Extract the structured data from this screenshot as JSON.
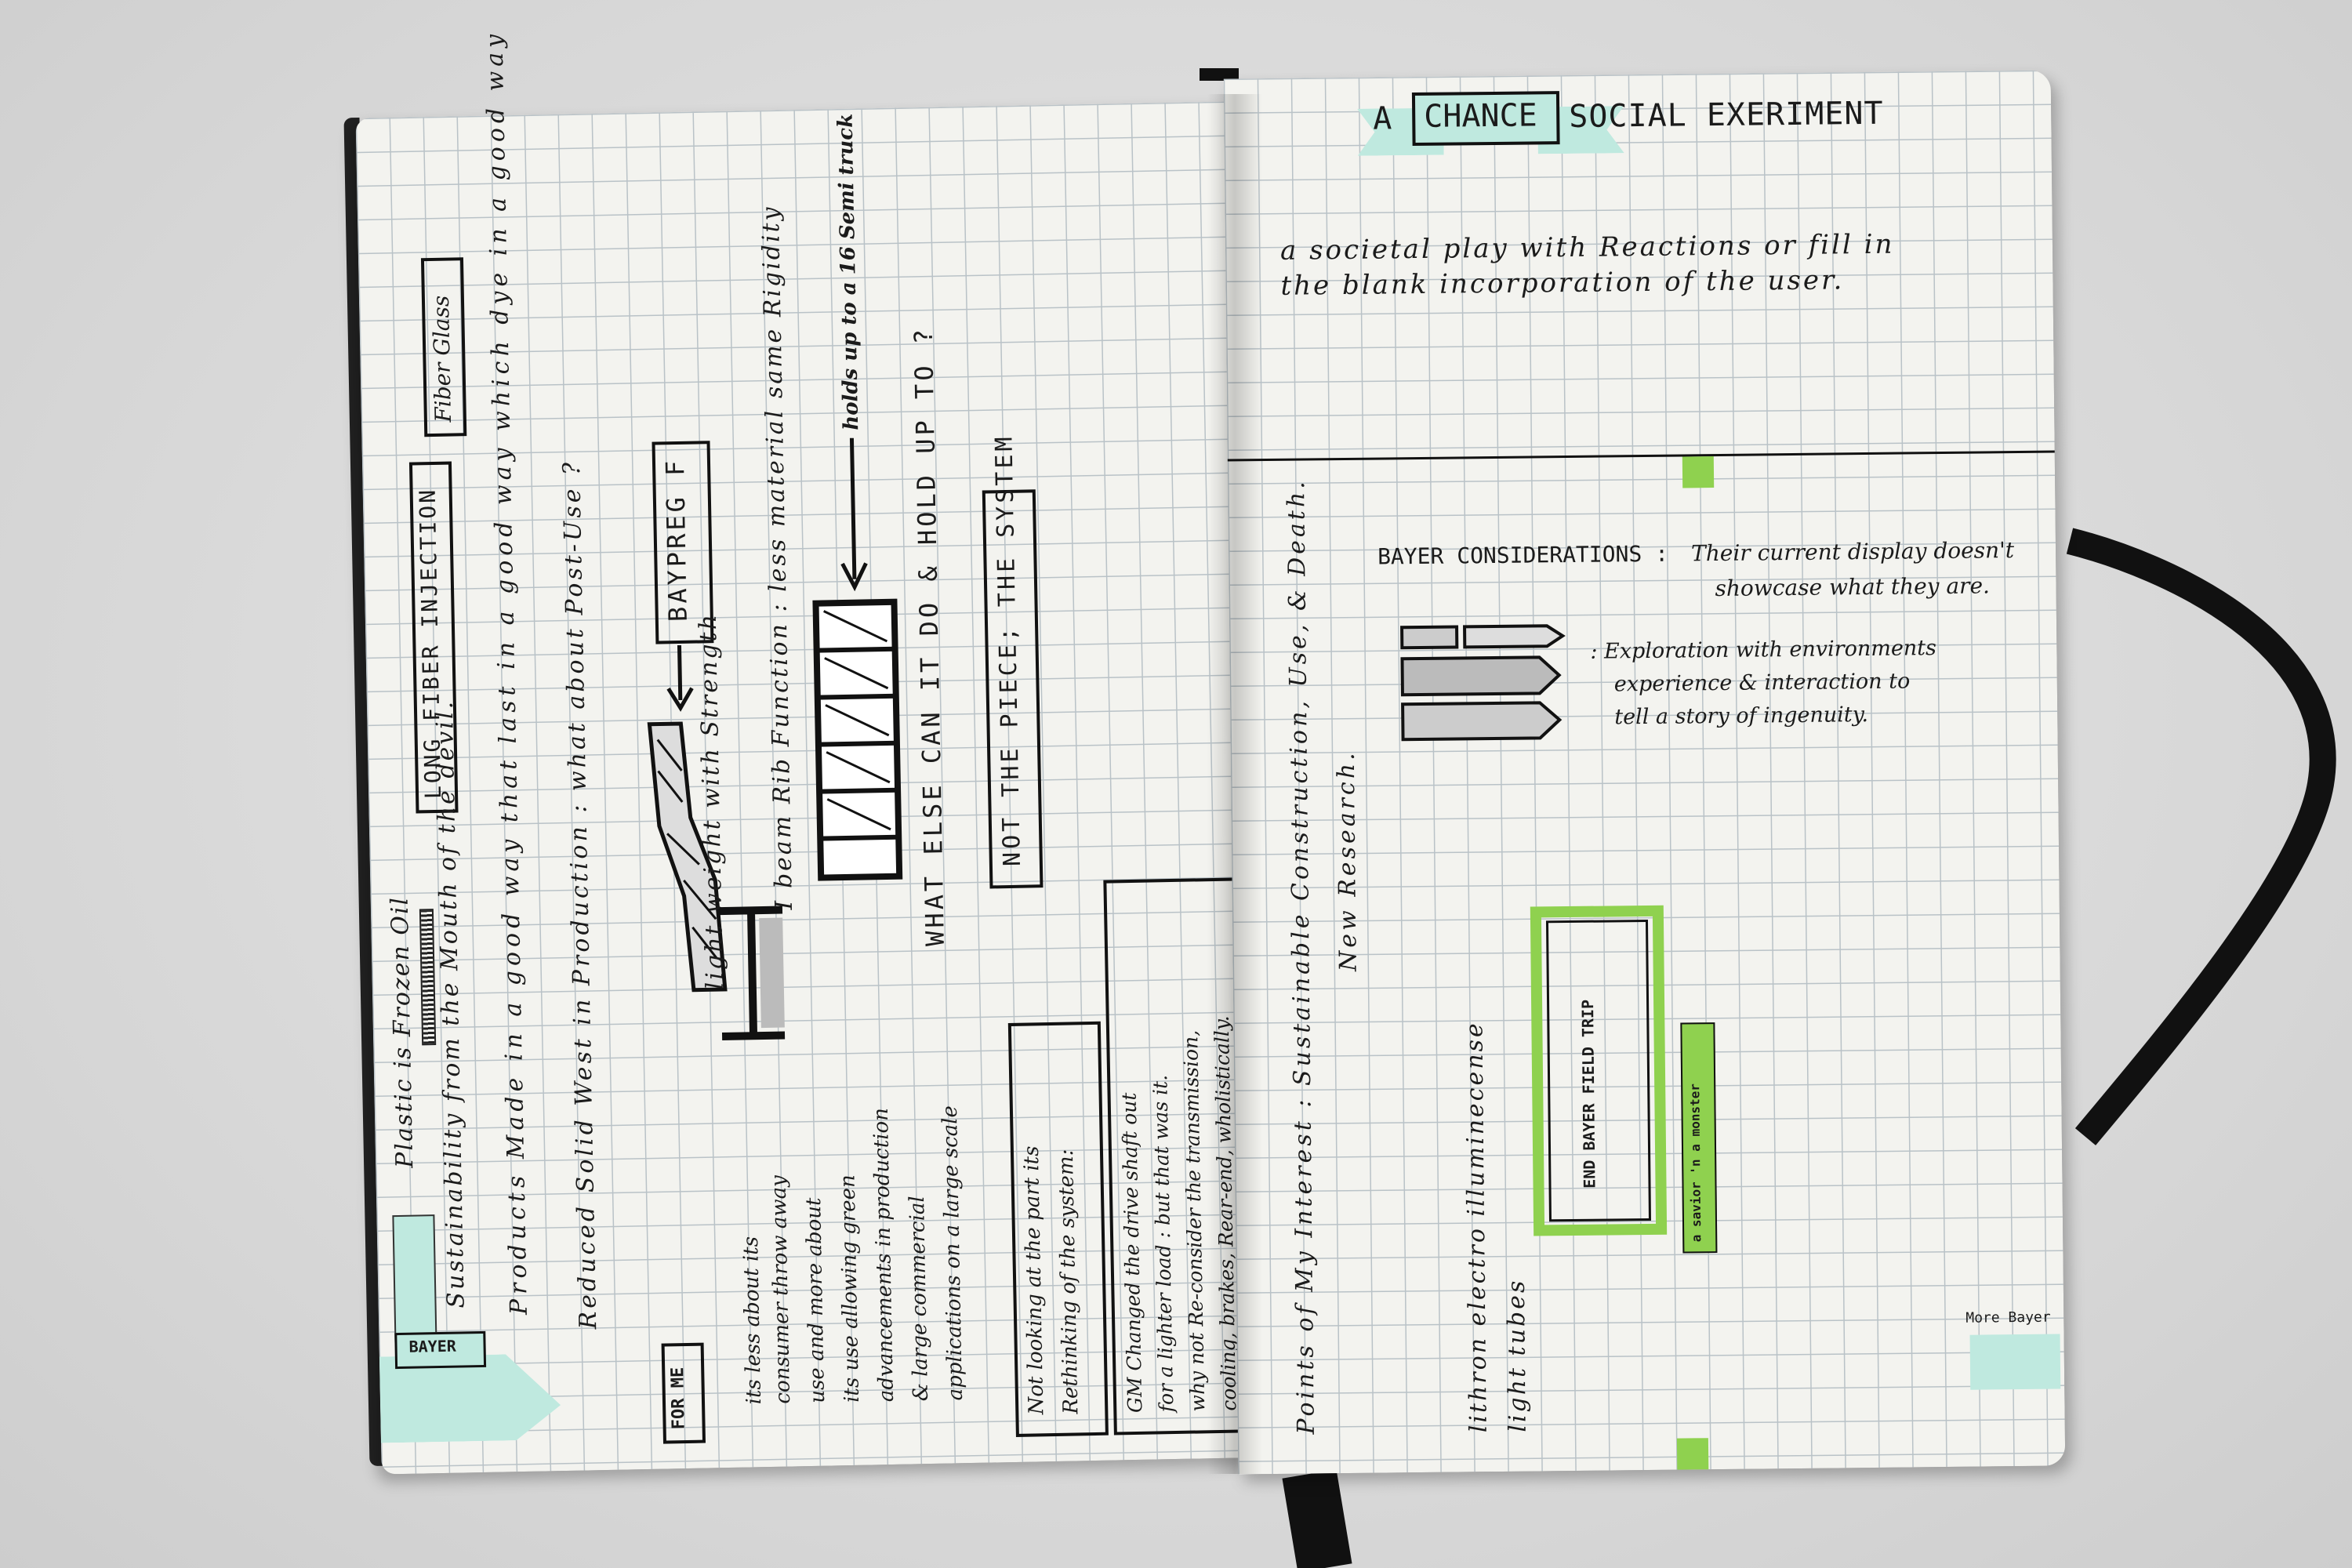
{
  "left_page": {
    "headings": {
      "injection": "LONG FIBER INJECTION",
      "glass": "Fiber Glass"
    },
    "lines": {
      "plastic": "Plastic is Frozen Oil",
      "sustain": "Sustainability from the Mouth of the devil.",
      "products": "Products Made in a good way that last in a good way which dye in a good way",
      "reduced": "Reduced Solid West in Production : what about Post-Use ?",
      "baypreg": "BAYPREG F",
      "light": "light weight with Strength",
      "ibeam": "I beam Rib Function : less material same Rigidity",
      "holds": "holds up to a 16 Semi truck",
      "what_else": "WHAT ELSE CAN IT DO & HOLD UP TO ?",
      "not_piece": "NOT THE PIECE; THE SYSTEM",
      "consumer": [
        "its less about its",
        "consumer throw away",
        "use and more about",
        "its use allowing green",
        "advancements in production",
        "& large commercial",
        "applications on a large scale"
      ],
      "not_looking": "Not looking at the part its",
      "rethinking": "Rethinking of the system:",
      "gm": [
        "GM Changed the drive shaft out",
        "for a lighter load : but that was it.",
        "why not Re-consider the transmission,",
        "cooling, brakes, Rear-end, wholistically."
      ],
      "bayer_tag": "BAYER",
      "for_me": "FOR ME"
    }
  },
  "right_page": {
    "title": {
      "a": "A",
      "chance": "CHANCE",
      "rest": "SOCIAL EXERIMENT"
    },
    "intro": [
      "a societal play with Reactions or fill in",
      "the blank incorporation of the user."
    ],
    "bayer_considerations": {
      "label": "BAYER CONSIDERATIONS :",
      "text": [
        "Their current display doesn't",
        "showcase what they are."
      ],
      "bullet": [
        ": Exploration with environments",
        "experience & interaction to",
        "tell a story of ingenuity."
      ]
    },
    "points": "Points of My Interest : Sustainable Construction, Use, & Death.",
    "new_research": "New Research.",
    "lithron": "lithron electro illuminecense",
    "light_tubes": "light tubes",
    "field_trip": "END BAYER FIELD TRIP",
    "savior": "a savior 'n a monster",
    "more_bayer": "More Bayer"
  },
  "colors": {
    "mint": "#bfe9df",
    "lime": "#8fd14f",
    "ink": "#1b1b1b",
    "paper": "#f3f3ef"
  }
}
